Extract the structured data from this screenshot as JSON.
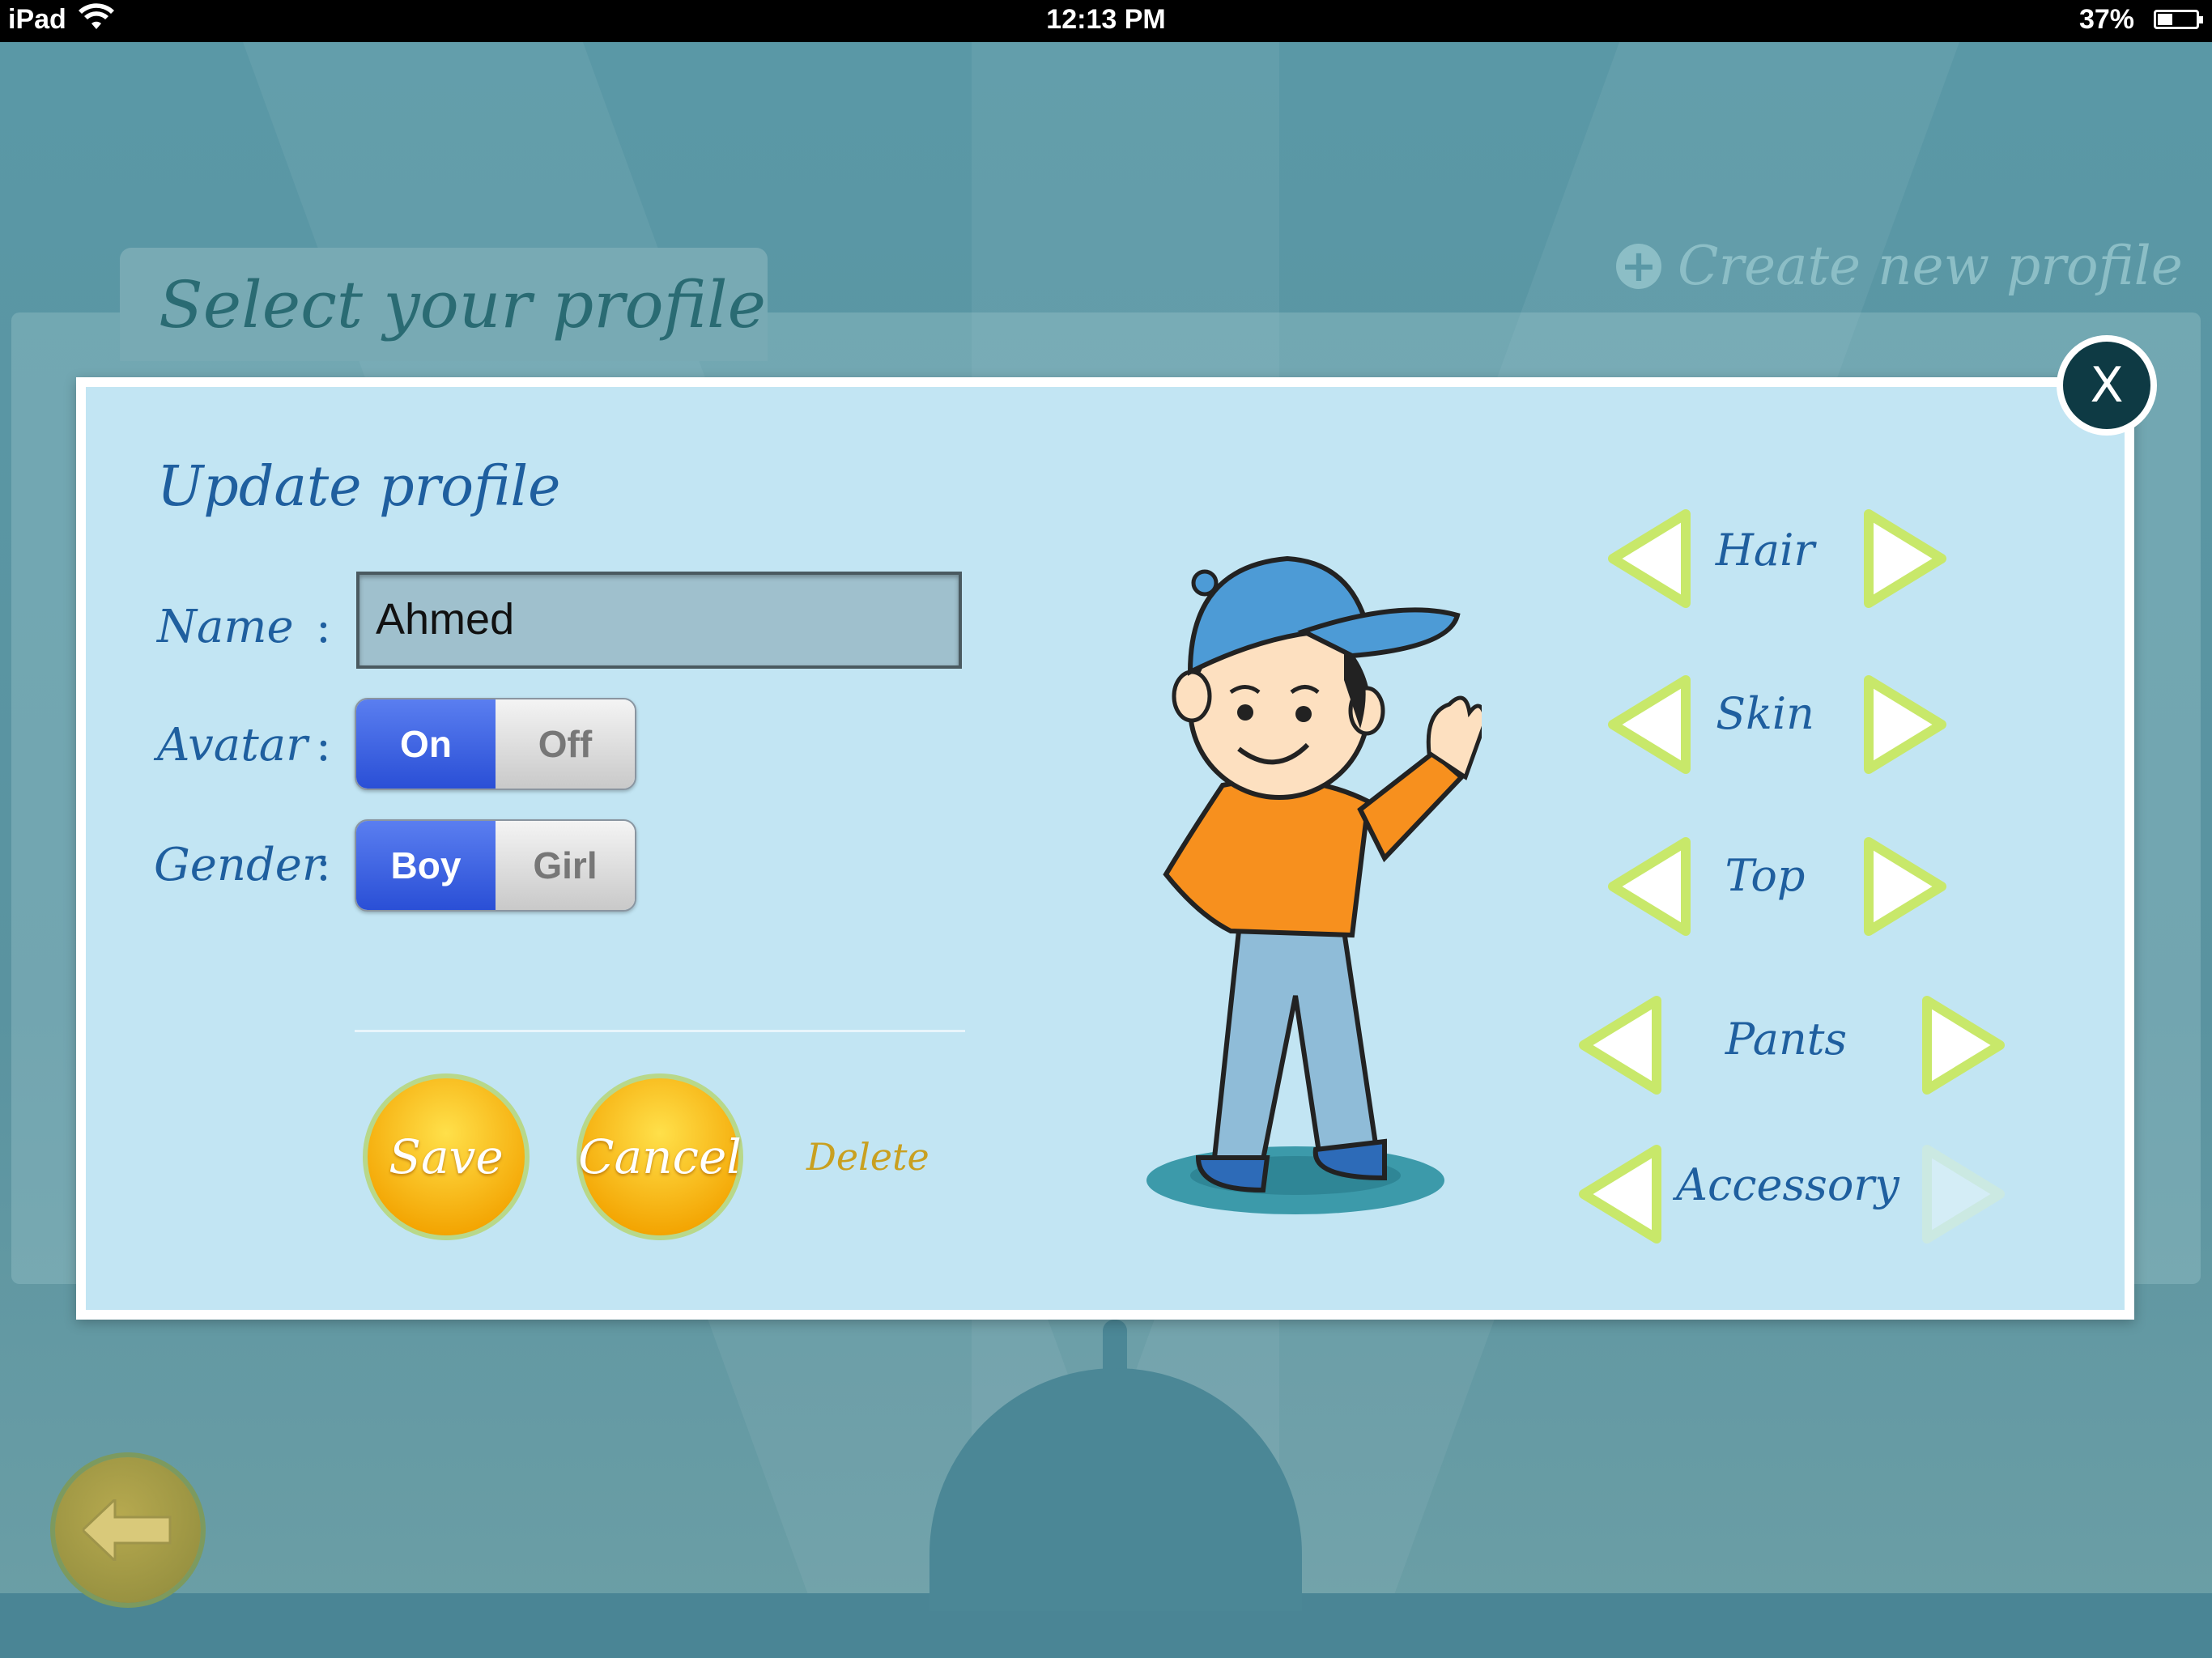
{
  "status_bar": {
    "device": "iPad",
    "time": "12:13 PM",
    "battery_percent": "37%"
  },
  "screen": {
    "title": "Select your profile",
    "create_new_profile": "Create new profile"
  },
  "dialog": {
    "title": "Update profile",
    "close_label": "X",
    "fields": {
      "name_label": "Name",
      "name_value": "Ahmed",
      "avatar_label": "Avatar",
      "avatar_options": [
        "On",
        "Off"
      ],
      "avatar_selected": "On",
      "gender_label": "Gender",
      "gender_options": [
        "Boy",
        "Girl"
      ],
      "gender_selected": "Boy",
      "separator": ":"
    },
    "actions": {
      "save": "Save",
      "cancel": "Cancel",
      "delete": "Delete"
    },
    "customize": {
      "options": [
        "Hair",
        "Skin",
        "Top",
        "Pants",
        "Accessory"
      ]
    }
  },
  "colors": {
    "accent_blue": "#2a4fd6",
    "button_yellow": "#f3a300",
    "arrow_green": "#c8e86a"
  }
}
